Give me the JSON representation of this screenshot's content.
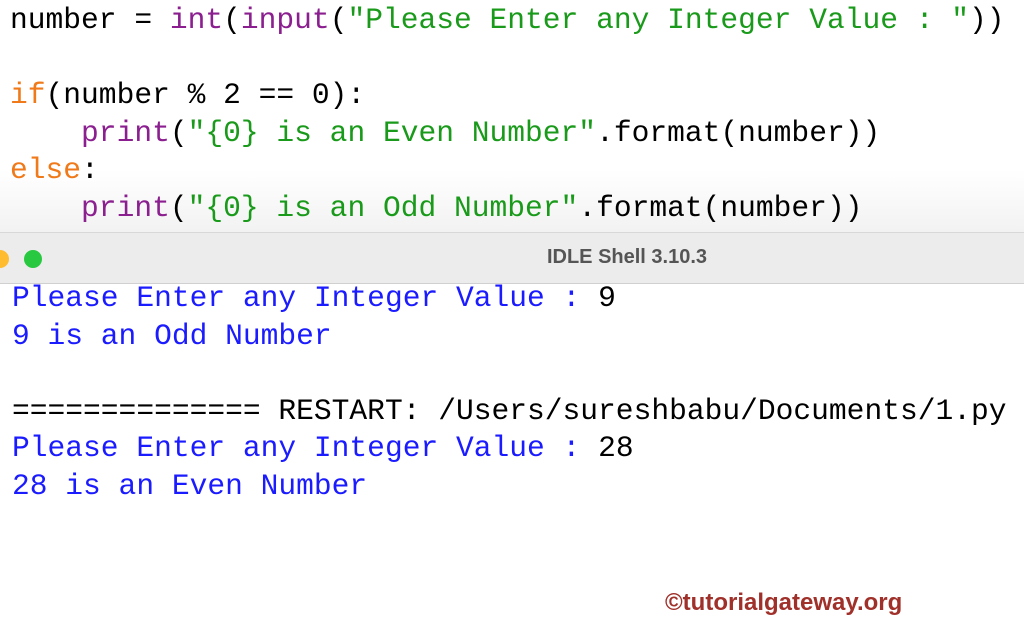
{
  "editor": {
    "lines": [
      [
        {
          "t": "number = ",
          "c": "tx"
        },
        {
          "t": "int",
          "c": "bi"
        },
        {
          "t": "(",
          "c": "tx"
        },
        {
          "t": "input",
          "c": "bi"
        },
        {
          "t": "(",
          "c": "tx"
        },
        {
          "t": "\"Please Enter any Integer Value : \"",
          "c": "st"
        },
        {
          "t": "))",
          "c": "tx"
        }
      ],
      [],
      [
        {
          "t": "if",
          "c": "kw"
        },
        {
          "t": "(number % 2 == 0):",
          "c": "tx"
        }
      ],
      [
        {
          "t": "    ",
          "c": "tx"
        },
        {
          "t": "print",
          "c": "bi"
        },
        {
          "t": "(",
          "c": "tx"
        },
        {
          "t": "\"{0} is an Even Number\"",
          "c": "st"
        },
        {
          "t": ".format(number))",
          "c": "tx"
        }
      ],
      [
        {
          "t": "else",
          "c": "kw"
        },
        {
          "t": ":",
          "c": "tx"
        }
      ],
      [
        {
          "t": "    ",
          "c": "tx"
        },
        {
          "t": "print",
          "c": "bi"
        },
        {
          "t": "(",
          "c": "tx"
        },
        {
          "t": "\"{0} is an Odd Number\"",
          "c": "st"
        },
        {
          "t": ".format(number))",
          "c": "tx"
        }
      ]
    ]
  },
  "shell": {
    "title": "IDLE Shell 3.10.3",
    "lines": [
      [
        {
          "t": "Please Enter any Integer Value : ",
          "c": "out"
        },
        {
          "t": "9",
          "c": "blk"
        }
      ],
      [
        {
          "t": "9 is an Odd Number",
          "c": "out"
        }
      ],
      [],
      [
        {
          "t": "============== RESTART: /Users/sureshbabu/Documents/1.py",
          "c": "blk"
        }
      ],
      [
        {
          "t": "Please Enter any Integer Value : ",
          "c": "out"
        },
        {
          "t": "28",
          "c": "blk"
        }
      ],
      [
        {
          "t": "28 is an Even Number",
          "c": "out"
        }
      ]
    ],
    "watermark": "©tutorialgateway.org"
  },
  "colors": {
    "keyword": "#f07a1a",
    "builtin": "#8b1f8f",
    "string": "#1a9a1a",
    "output": "#1b1bff",
    "close": "#ff5f57",
    "minimize": "#febc2e",
    "zoom": "#28c840"
  }
}
